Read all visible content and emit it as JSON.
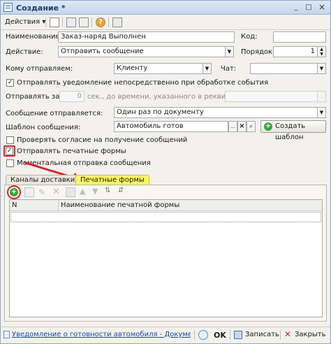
{
  "window": {
    "title": "Создание *",
    "controls": [
      "_",
      "□",
      "×"
    ]
  },
  "toolbar": {
    "actions_label": "Действия",
    "help_label": "?"
  },
  "form": {
    "name_label": "Наименование:",
    "name_value": "Заказ-наряд Выполнен",
    "code_label": "Код:",
    "code_value": "",
    "action_label": "Действие:",
    "action_value": "Отправить сообщение",
    "order_label": "Порядок:",
    "order_value": "1",
    "recipient_label": "Кому отправляем:",
    "recipient_value": "Клиенту",
    "chat_label": "Чат:",
    "chat_value": "",
    "notify_label": "Отправлять уведомление непосредственно при обработке события",
    "send_in_label": "Отправлять за",
    "send_in_value": "0",
    "send_in_suffix": "сек., до времени, указанного в реквизите",
    "sent_label": "Сообщение отправляется:",
    "sent_value": "Один раз по документу",
    "template_label": "Шаблон сообщения:",
    "template_value": "Автомобиль готов",
    "create_template_label": "Создать шаблон",
    "check_consent_label": "Проверять согласие на получение сообщений",
    "send_print_forms_label": "Отправлять печатные формы",
    "instant_send_label": "Моментальная отправка сообщения"
  },
  "tabs": [
    {
      "label": "Каналы доставки"
    },
    {
      "label": "Печатные формы"
    }
  ],
  "grid": {
    "columns": [
      "N",
      "Наименование печатной формы"
    ]
  },
  "status": {
    "link_text": "Уведомление о готовности автомобиля - Документ \"Зака...",
    "ok_label": "OK",
    "save_label": "Записать",
    "close_label": "Закрыть"
  },
  "colors": {
    "accent_tab": "#fff563",
    "highlight": "#d9232c",
    "add_icon": "#3aa43a"
  }
}
